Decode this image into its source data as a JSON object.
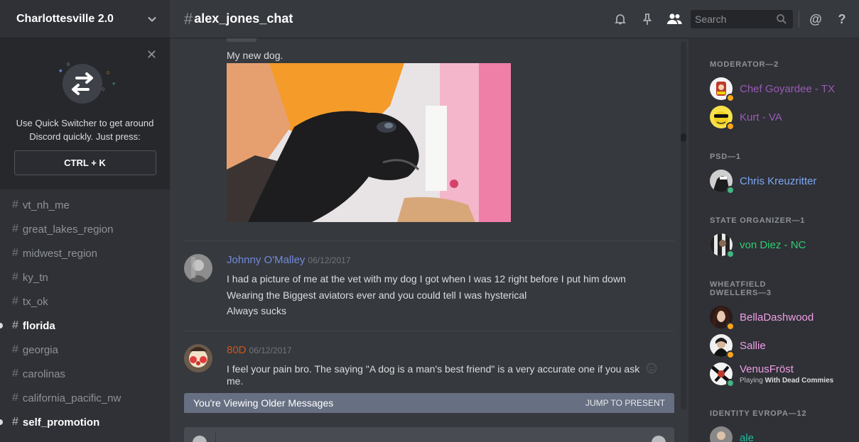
{
  "server": {
    "name": "Charlottesville 2.0"
  },
  "quick_switcher": {
    "tip": "Use Quick Switcher to get around Discord quickly. Just press:",
    "shortcut": "CTRL + K"
  },
  "channels": [
    {
      "name": "vt_nh_me",
      "unread": false
    },
    {
      "name": "great_lakes_region",
      "unread": false
    },
    {
      "name": "midwest_region",
      "unread": false
    },
    {
      "name": "ky_tn",
      "unread": false
    },
    {
      "name": "tx_ok",
      "unread": false
    },
    {
      "name": "florida",
      "unread": true
    },
    {
      "name": "georgia",
      "unread": false
    },
    {
      "name": "carolinas",
      "unread": false
    },
    {
      "name": "california_pacific_nw",
      "unread": false
    },
    {
      "name": "self_promotion",
      "unread": true
    }
  ],
  "header": {
    "hash": "#",
    "channel": "alex_jones_chat",
    "search_placeholder": "Search",
    "mention_glyph": "@",
    "help_glyph": "?"
  },
  "messages": {
    "caption": "My new dog.",
    "items": [
      {
        "author": "Johnny O'Malley",
        "color": "#7289da",
        "timestamp": "06/12/2017",
        "lines": [
          "I had a picture of me at the vet with my dog I got when I was 12 right before I put him down",
          "Wearing the Biggest aviators ever and you could tell I was hysterical",
          "Always sucks"
        ]
      },
      {
        "author": "80D",
        "color": "#c8571c",
        "timestamp": "06/12/2017",
        "lines": [
          "I feel your pain bro. The saying \"A dog is a man's best friend\" is a very accurate one if you ask",
          "me."
        ]
      }
    ],
    "older_bar": {
      "text": "You're Viewing Older Messages",
      "jump": "JUMP TO PRESENT"
    }
  },
  "members": {
    "roles": [
      {
        "label": "MODERATOR—2"
      },
      {
        "label": "PSD—1"
      },
      {
        "label": "STATE ORGANIZER—1"
      },
      {
        "label": "WHEATFIELD"
      },
      {
        "label": "DWELLERS—3"
      },
      {
        "label": "IDENTITY EVROPA—12"
      }
    ],
    "list": [
      {
        "name": "Chef Goyardee - TX",
        "color": "#9b59b6",
        "status": "#faa61a"
      },
      {
        "name": "Kurt - VA",
        "color": "#9b59b6",
        "status": "#faa61a"
      },
      {
        "name": "Chris Kreuzritter",
        "color": "#7ea7f2",
        "status": "#43b581"
      },
      {
        "name": "von Diez - NC",
        "color": "#2ecc71",
        "status": "#43b581"
      },
      {
        "name": "BellaDashwood",
        "color": "#f19ee6",
        "status": "#faa61a"
      },
      {
        "name": "Sallie",
        "color": "#f19ee6",
        "status": "#faa61a"
      },
      {
        "name": "VenusFröst",
        "color": "#f19ee6",
        "status": "#43b581",
        "playing_prefix": "Playing",
        "game": "With Dead Commies"
      },
      {
        "name": "ale",
        "color": "#1abc9c",
        "status": "#43b581"
      }
    ]
  },
  "colors": {
    "accent": "#7289da",
    "older_bar": "#677082",
    "online": "#43b581",
    "idle": "#faa61a"
  }
}
